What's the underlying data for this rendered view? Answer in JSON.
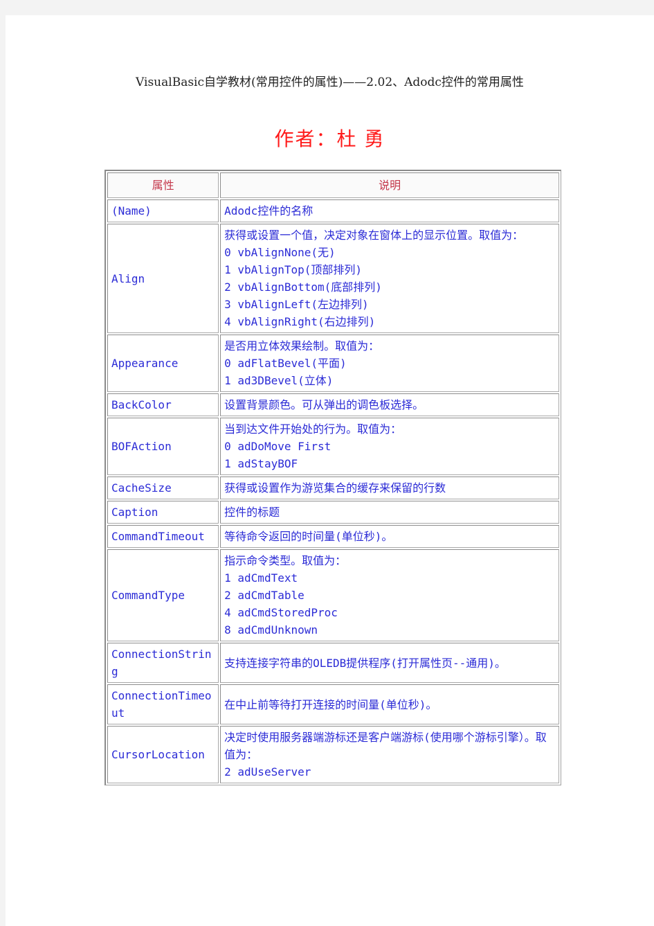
{
  "document": {
    "title": "VisualBasic自学教材(常用控件的属性)——2.02、Adodc控件的常用属性",
    "author_label": "作者：",
    "author_name_first": "杜",
    "author_name_last": "勇"
  },
  "table": {
    "headers": {
      "property": "属性",
      "description": "说明"
    },
    "rows": [
      {
        "name": "(Name)",
        "description": [
          "Adodc控件的名称"
        ]
      },
      {
        "name": "Align",
        "description": [
          "获得或设置一个值，决定对象在窗体上的显示位置。取值为：",
          "0 vbAlignNone(无)",
          "1 vbAlignTop(顶部排列)",
          "2 vbAlignBottom(底部排列)",
          "3 vbAlignLeft(左边排列)",
          "4 vbAlignRight(右边排列)"
        ]
      },
      {
        "name": "Appearance",
        "description": [
          "是否用立体效果绘制。取值为：",
          "0 adFlatBevel(平面)",
          "1 ad3DBevel(立体)"
        ]
      },
      {
        "name": "BackColor",
        "description": [
          "设置背景颜色。可从弹出的调色板选择。"
        ]
      },
      {
        "name": "BOFAction",
        "description": [
          "当到达文件开始处的行为。取值为：",
          "0 adDoMove First",
          "1 adStayBOF"
        ]
      },
      {
        "name": "CacheSize",
        "description": [
          "获得或设置作为游览集合的缓存来保留的行数"
        ]
      },
      {
        "name": "Caption",
        "description": [
          "控件的标题"
        ]
      },
      {
        "name": "CommandTimeout",
        "description": [
          "等待命令返回的时间量(单位秒)。"
        ]
      },
      {
        "name": "CommandType",
        "description": [
          "指示命令类型。取值为：",
          "1 adCmdText",
          "2 adCmdTable",
          "4 adCmdStoredProc",
          "8 adCmdUnknown"
        ]
      },
      {
        "name": "ConnectionString",
        "description": [
          "支持连接字符串的OLEDB提供程序(打开属性页--通用)。"
        ]
      },
      {
        "name": "ConnectionTimeout",
        "description": [
          "在中止前等待打开连接的时间量(单位秒)。"
        ]
      },
      {
        "name": "CursorLocation",
        "description": [
          "决定时使用服务器端游标还是客户端游标(使用哪个游标引擎）。取值为：",
          "2 adUseServer"
        ]
      }
    ]
  },
  "colors": {
    "title_text": "#222222",
    "author_text": "#ff1a1a",
    "header_text": "#c4364a",
    "body_text": "#2b2bd6",
    "page_background": "#f3f3f3"
  }
}
